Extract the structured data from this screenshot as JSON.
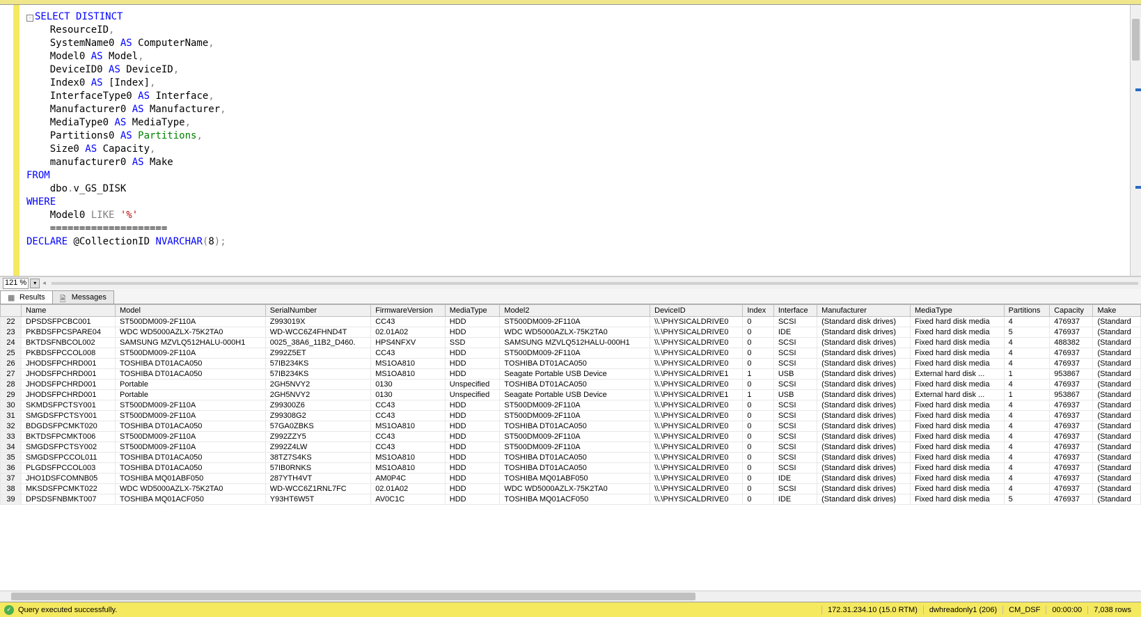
{
  "zoom": "121 %",
  "tabs": {
    "results": "Results",
    "messages": "Messages"
  },
  "sql_tokens": [
    [
      {
        "c": "collapse"
      },
      {
        "t": "SELECT",
        "c": "blue"
      },
      {
        "t": " "
      },
      {
        "t": "DISTINCT",
        "c": "blue"
      }
    ],
    [
      {
        "t": "    ResourceID"
      },
      {
        "t": ",",
        "c": "gray"
      }
    ],
    [
      {
        "t": "    SystemName0 "
      },
      {
        "t": "AS",
        "c": "blue"
      },
      {
        "t": " ComputerName"
      },
      {
        "t": ",",
        "c": "gray"
      }
    ],
    [
      {
        "t": "    Model0 "
      },
      {
        "t": "AS",
        "c": "blue"
      },
      {
        "t": " Model"
      },
      {
        "t": ",",
        "c": "gray"
      }
    ],
    [
      {
        "t": "    DeviceID0 "
      },
      {
        "t": "AS",
        "c": "blue"
      },
      {
        "t": " DeviceID"
      },
      {
        "t": ",",
        "c": "gray"
      }
    ],
    [
      {
        "t": "    Index0 "
      },
      {
        "t": "AS",
        "c": "blue"
      },
      {
        "t": " [Index]"
      },
      {
        "t": ",",
        "c": "gray"
      }
    ],
    [
      {
        "t": "    InterfaceType0 "
      },
      {
        "t": "AS",
        "c": "blue"
      },
      {
        "t": " Interface"
      },
      {
        "t": ",",
        "c": "gray"
      }
    ],
    [
      {
        "t": "    Manufacturer0 "
      },
      {
        "t": "AS",
        "c": "blue"
      },
      {
        "t": " Manufacturer"
      },
      {
        "t": ",",
        "c": "gray"
      }
    ],
    [
      {
        "t": "    MediaType0 "
      },
      {
        "t": "AS",
        "c": "blue"
      },
      {
        "t": " MediaType"
      },
      {
        "t": ",",
        "c": "gray"
      }
    ],
    [
      {
        "t": "    Partitions0 "
      },
      {
        "t": "AS",
        "c": "blue"
      },
      {
        "t": " "
      },
      {
        "t": "Partitions",
        "c": "green"
      },
      {
        "t": ",",
        "c": "gray"
      }
    ],
    [
      {
        "t": "    Size0 "
      },
      {
        "t": "AS",
        "c": "blue"
      },
      {
        "t": " Capacity"
      },
      {
        "t": ",",
        "c": "gray"
      }
    ],
    [
      {
        "t": "    manufacturer0 "
      },
      {
        "t": "AS",
        "c": "blue"
      },
      {
        "t": " Make"
      }
    ],
    [
      {
        "t": "FROM",
        "c": "blue"
      }
    ],
    [
      {
        "t": "    dbo"
      },
      {
        "t": ".",
        "c": "gray"
      },
      {
        "t": "v_GS_DISK"
      }
    ],
    [
      {
        "t": "WHERE",
        "c": "blue"
      }
    ],
    [
      {
        "t": "    Model0 "
      },
      {
        "t": "LIKE",
        "c": "gray"
      },
      {
        "t": " "
      },
      {
        "t": "'%'",
        "c": "red"
      }
    ],
    [
      {
        "t": ""
      }
    ],
    [
      {
        "t": "    ===================="
      }
    ],
    [
      {
        "t": ""
      }
    ],
    [
      {
        "t": "DECLARE",
        "c": "blue"
      },
      {
        "t": " @CollectionID "
      },
      {
        "t": "NVARCHAR",
        "c": "blue"
      },
      {
        "t": "(",
        "c": "gray"
      },
      {
        "t": "8"
      },
      {
        "t": ");",
        "c": "gray"
      }
    ]
  ],
  "columns": [
    "",
    "Name",
    "Model",
    "SerialNumber",
    "FirmwareVersion",
    "MediaType",
    "Model2",
    "DeviceID",
    "Index",
    "Interface",
    "Manufacturer",
    "MediaType",
    "Partitions",
    "Capacity",
    "Make"
  ],
  "rows": [
    {
      "n": "22",
      "d": [
        "DPSDSFPCBC001",
        "ST500DM009-2F110A",
        "Z993019X",
        "CC43",
        "HDD",
        "ST500DM009-2F110A",
        "\\\\.\\PHYSICALDRIVE0",
        "0",
        "SCSI",
        "(Standard disk drives)",
        "Fixed hard disk media",
        "4",
        "476937",
        "(Standard"
      ]
    },
    {
      "n": "23",
      "d": [
        "PKBDSFPCSPARE04",
        "WDC WD5000AZLX-75K2TA0",
        "WD-WCC6Z4FHND4T",
        "02.01A02",
        "HDD",
        "WDC WD5000AZLX-75K2TA0",
        "\\\\.\\PHYSICALDRIVE0",
        "0",
        "IDE",
        "(Standard disk drives)",
        "Fixed hard disk media",
        "5",
        "476937",
        "(Standard"
      ]
    },
    {
      "n": "24",
      "d": [
        "BKTDSFNBCOL002",
        "SAMSUNG MZVLQ512HALU-000H1",
        "0025_38A6_11B2_D460.",
        "HPS4NFXV",
        "SSD",
        "SAMSUNG MZVLQ512HALU-000H1",
        "\\\\.\\PHYSICALDRIVE0",
        "0",
        "SCSI",
        "(Standard disk drives)",
        "Fixed hard disk media",
        "4",
        "488382",
        "(Standard"
      ]
    },
    {
      "n": "25",
      "d": [
        "PKBDSFPCCOL008",
        "ST500DM009-2F110A",
        "Z992Z5ET",
        "CC43",
        "HDD",
        "ST500DM009-2F110A",
        "\\\\.\\PHYSICALDRIVE0",
        "0",
        "SCSI",
        "(Standard disk drives)",
        "Fixed hard disk media",
        "4",
        "476937",
        "(Standard"
      ]
    },
    {
      "n": "26",
      "d": [
        "JHODSFPCHRD001",
        "TOSHIBA DT01ACA050",
        "57IB234KS",
        "MS1OA810",
        "HDD",
        "TOSHIBA DT01ACA050",
        "\\\\.\\PHYSICALDRIVE0",
        "0",
        "SCSI",
        "(Standard disk drives)",
        "Fixed hard disk media",
        "4",
        "476937",
        "(Standard"
      ]
    },
    {
      "n": "27",
      "d": [
        "JHODSFPCHRD001",
        "TOSHIBA DT01ACA050",
        "57IB234KS",
        "MS1OA810",
        "HDD",
        "Seagate Portable USB Device",
        "\\\\.\\PHYSICALDRIVE1",
        "1",
        "USB",
        "(Standard disk drives)",
        "External hard disk ...",
        "1",
        "953867",
        "(Standard"
      ]
    },
    {
      "n": "28",
      "d": [
        "JHODSFPCHRD001",
        "Portable",
        "2GH5NVY2",
        "0130",
        "Unspecified",
        "TOSHIBA DT01ACA050",
        "\\\\.\\PHYSICALDRIVE0",
        "0",
        "SCSI",
        "(Standard disk drives)",
        "Fixed hard disk media",
        "4",
        "476937",
        "(Standard"
      ]
    },
    {
      "n": "29",
      "d": [
        "JHODSFPCHRD001",
        "Portable",
        "2GH5NVY2",
        "0130",
        "Unspecified",
        "Seagate Portable USB Device",
        "\\\\.\\PHYSICALDRIVE1",
        "1",
        "USB",
        "(Standard disk drives)",
        "External hard disk ...",
        "1",
        "953867",
        "(Standard"
      ]
    },
    {
      "n": "30",
      "d": [
        "SKMDSFPCTSY001",
        "ST500DM009-2F110A",
        "Z99300Z6",
        "CC43",
        "HDD",
        "ST500DM009-2F110A",
        "\\\\.\\PHYSICALDRIVE0",
        "0",
        "SCSI",
        "(Standard disk drives)",
        "Fixed hard disk media",
        "4",
        "476937",
        "(Standard"
      ]
    },
    {
      "n": "31",
      "d": [
        "SMGDSFPCTSY001",
        "ST500DM009-2F110A",
        "Z99308G2",
        "CC43",
        "HDD",
        "ST500DM009-2F110A",
        "\\\\.\\PHYSICALDRIVE0",
        "0",
        "SCSI",
        "(Standard disk drives)",
        "Fixed hard disk media",
        "4",
        "476937",
        "(Standard"
      ]
    },
    {
      "n": "32",
      "d": [
        "BDGDSFPCMKT020",
        "TOSHIBA DT01ACA050",
        "57GA0ZBKS",
        "MS1OA810",
        "HDD",
        "TOSHIBA DT01ACA050",
        "\\\\.\\PHYSICALDRIVE0",
        "0",
        "SCSI",
        "(Standard disk drives)",
        "Fixed hard disk media",
        "4",
        "476937",
        "(Standard"
      ]
    },
    {
      "n": "33",
      "d": [
        "BKTDSFPCMKT006",
        "ST500DM009-2F110A",
        "Z992ZZY5",
        "CC43",
        "HDD",
        "ST500DM009-2F110A",
        "\\\\.\\PHYSICALDRIVE0",
        "0",
        "SCSI",
        "(Standard disk drives)",
        "Fixed hard disk media",
        "4",
        "476937",
        "(Standard"
      ]
    },
    {
      "n": "34",
      "d": [
        "SMGDSFPCTSY002",
        "ST500DM009-2F110A",
        "Z992Z4LW",
        "CC43",
        "HDD",
        "ST500DM009-2F110A",
        "\\\\.\\PHYSICALDRIVE0",
        "0",
        "SCSI",
        "(Standard disk drives)",
        "Fixed hard disk media",
        "4",
        "476937",
        "(Standard"
      ]
    },
    {
      "n": "35",
      "d": [
        "SMGDSFPCCOL011",
        "TOSHIBA DT01ACA050",
        "38TZ7S4KS",
        "MS1OA810",
        "HDD",
        "TOSHIBA DT01ACA050",
        "\\\\.\\PHYSICALDRIVE0",
        "0",
        "SCSI",
        "(Standard disk drives)",
        "Fixed hard disk media",
        "4",
        "476937",
        "(Standard"
      ]
    },
    {
      "n": "36",
      "d": [
        "PLGDSFPCCOL003",
        "TOSHIBA DT01ACA050",
        "57IB0RNKS",
        "MS1OA810",
        "HDD",
        "TOSHIBA DT01ACA050",
        "\\\\.\\PHYSICALDRIVE0",
        "0",
        "SCSI",
        "(Standard disk drives)",
        "Fixed hard disk media",
        "4",
        "476937",
        "(Standard"
      ]
    },
    {
      "n": "37",
      "d": [
        "JHO1DSFCOMNB05",
        "TOSHIBA MQ01ABF050",
        "287YTH4VT",
        "AM0P4C",
        "HDD",
        "TOSHIBA MQ01ABF050",
        "\\\\.\\PHYSICALDRIVE0",
        "0",
        "IDE",
        "(Standard disk drives)",
        "Fixed hard disk media",
        "4",
        "476937",
        "(Standard"
      ]
    },
    {
      "n": "38",
      "d": [
        "MKSDSFPCMKT022",
        "WDC WD5000AZLX-75K2TA0",
        "WD-WCC6Z1RNL7FC",
        "02.01A02",
        "HDD",
        "WDC WD5000AZLX-75K2TA0",
        "\\\\.\\PHYSICALDRIVE0",
        "0",
        "SCSI",
        "(Standard disk drives)",
        "Fixed hard disk media",
        "4",
        "476937",
        "(Standard"
      ]
    },
    {
      "n": "39",
      "d": [
        "DPSDSFNBMKT007",
        "TOSHIBA MQ01ACF050",
        "Y93HT6W5T",
        "AV0C1C",
        "HDD",
        "TOSHIBA MQ01ACF050",
        "\\\\.\\PHYSICALDRIVE0",
        "0",
        "IDE",
        "(Standard disk drives)",
        "Fixed hard disk media",
        "5",
        "476937",
        "(Standard"
      ]
    }
  ],
  "status": {
    "message": "Query executed successfully.",
    "server": "172.31.234.10 (15.0 RTM)",
    "user": "dwhreadonly1 (206)",
    "database": "CM_DSF",
    "elapsed": "00:00:00",
    "rows": "7,038 rows"
  }
}
